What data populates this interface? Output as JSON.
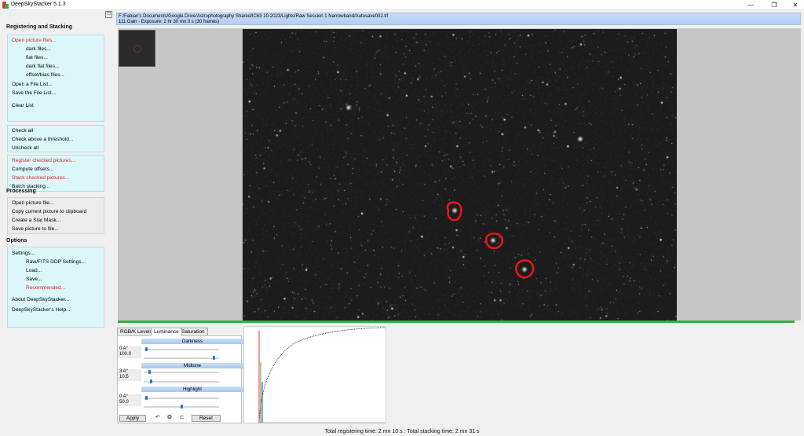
{
  "window": {
    "title": "DeepSkyStacker 5.1.3",
    "minimize": "—",
    "restore": "❐",
    "close": "✕"
  },
  "sidebar": {
    "registering_title": "Registering and Stacking",
    "open_group": {
      "open_pictures": "Open picture files...",
      "dark": "dark files...",
      "flat": "flat files...",
      "dark_flat": "dark flat files...",
      "offset_bias": "offset/bias files...",
      "open_list": "Open a File List...",
      "save_list": "Save the File List...",
      "clear_list": "Clear List"
    },
    "check_group": {
      "check_all": "Check all",
      "check_threshold": "Check above a threshold...",
      "uncheck_all": "Uncheck all"
    },
    "stack_group": {
      "register": "Register checked pictures...",
      "compute_offsets": "Compute offsets...",
      "stack": "Stack checked pictures...",
      "batch": "Batch stacking..."
    },
    "processing_title": "Processing",
    "processing": {
      "open": "Open picture file...",
      "copy": "Copy current picture to clipboard",
      "star_mask": "Create a Star Mask...",
      "save": "Save picture to file..."
    },
    "options_title": "Options",
    "options": {
      "settings": "Settings...",
      "raw_fits": "Raw/FITS DDP Settings...",
      "load": "Load...",
      "save": "Save...",
      "recommended": "Recommended...",
      "about": "About DeepSkyStacker...",
      "help": "DeepSkyStacker's Help..."
    }
  },
  "file_info": {
    "path": "F:/Fabian's Documents/Google Drive/Astrophotography Shared/IC63 10-2023/Lights/Raw Session 1 Narrowband/Autosave002.tif",
    "exposure": "111 Gain - Exposure: 2 hr 30 mn 0 s (30 frames)"
  },
  "tabs": [
    "RGB/K Levels",
    "Luminance",
    "Saturation"
  ],
  "active_tab": "Luminance",
  "luminance": {
    "darkness_label": "Darkness",
    "darkness_top": "0 A°",
    "darkness_value": "100.0",
    "darkness_slider1": 0.02,
    "darkness_slider2": 0.95,
    "midtone_label": "Midtone",
    "midtone_top": "3 A°",
    "midtone_value": "10.5",
    "midtone_slider1": 0.06,
    "midtone_slider2": 0.09,
    "highlight_label": "Highlight",
    "highlight_top": "0 A°",
    "highlight_value": "50.0",
    "highlight_slider1": 0.02,
    "highlight_slider2": 0.5,
    "apply": "Apply",
    "reset": "Reset",
    "undo_icon": "↶",
    "settings_icon": "❂",
    "redo_icon": "⊏"
  },
  "status": {
    "text": "Total registering time: 2 mn 10 s  : Total stacking time: 2 mn 31 s"
  },
  "colors": {
    "accent_red": "#e02222",
    "sidebar_group": "#dcf7f9",
    "progress_green": "#2fb33a",
    "circle_red": "#e8141a"
  }
}
